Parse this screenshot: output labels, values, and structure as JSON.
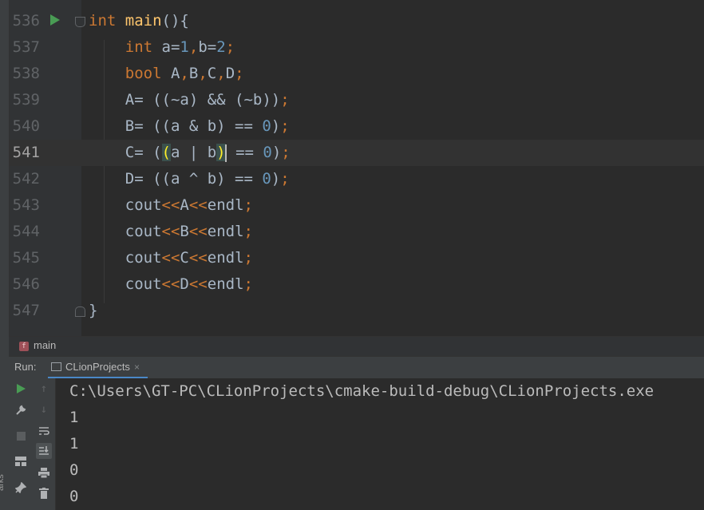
{
  "editor": {
    "lines": [
      {
        "num": "536",
        "tokens": [
          [
            "kw",
            "int"
          ],
          [
            "txt",
            " "
          ],
          [
            "fn",
            "main"
          ],
          [
            "txt",
            "(){"
          ]
        ]
      },
      {
        "num": "537",
        "tokens": [
          [
            "txt",
            "    "
          ],
          [
            "kw",
            "int"
          ],
          [
            "txt",
            " a="
          ],
          [
            "num",
            "1"
          ],
          [
            "kw",
            ","
          ],
          [
            "txt",
            "b="
          ],
          [
            "num",
            "2"
          ],
          [
            "kw",
            ";"
          ]
        ]
      },
      {
        "num": "538",
        "tokens": [
          [
            "txt",
            "    "
          ],
          [
            "kw",
            "bool"
          ],
          [
            "txt",
            " A"
          ],
          [
            "kw",
            ","
          ],
          [
            "txt",
            "B"
          ],
          [
            "kw",
            ","
          ],
          [
            "txt",
            "C"
          ],
          [
            "kw",
            ","
          ],
          [
            "txt",
            "D"
          ],
          [
            "kw",
            ";"
          ]
        ]
      },
      {
        "num": "539",
        "tokens": [
          [
            "txt",
            "    A= ((~a) && (~b))"
          ],
          [
            "kw",
            ";"
          ]
        ]
      },
      {
        "num": "540",
        "tokens": [
          [
            "txt",
            "    B= ((a & b) == "
          ],
          [
            "num",
            "0"
          ],
          [
            "txt",
            ")"
          ],
          [
            "kw",
            ";"
          ]
        ]
      },
      {
        "num": "541",
        "current": true,
        "tokens": [
          [
            "txt",
            "    C= ("
          ],
          [
            "hl",
            "("
          ],
          [
            "txt",
            "a | b"
          ],
          [
            "hl",
            ")"
          ],
          [
            "caret",
            ""
          ],
          [
            "txt",
            " == "
          ],
          [
            "num",
            "0"
          ],
          [
            "txt",
            ")"
          ],
          [
            "kw",
            ";"
          ]
        ]
      },
      {
        "num": "542",
        "tokens": [
          [
            "txt",
            "    D= ((a ^ b) == "
          ],
          [
            "num",
            "0"
          ],
          [
            "txt",
            ")"
          ],
          [
            "kw",
            ";"
          ]
        ]
      },
      {
        "num": "543",
        "tokens": [
          [
            "txt",
            "    cout"
          ],
          [
            "kw",
            "<<"
          ],
          [
            "txt",
            "A"
          ],
          [
            "kw",
            "<<"
          ],
          [
            "txt",
            "endl"
          ],
          [
            "kw",
            ";"
          ]
        ]
      },
      {
        "num": "544",
        "tokens": [
          [
            "txt",
            "    cout"
          ],
          [
            "kw",
            "<<"
          ],
          [
            "txt",
            "B"
          ],
          [
            "kw",
            "<<"
          ],
          [
            "txt",
            "endl"
          ],
          [
            "kw",
            ";"
          ]
        ]
      },
      {
        "num": "545",
        "tokens": [
          [
            "txt",
            "    cout"
          ],
          [
            "kw",
            "<<"
          ],
          [
            "txt",
            "C"
          ],
          [
            "kw",
            "<<"
          ],
          [
            "txt",
            "endl"
          ],
          [
            "kw",
            ";"
          ]
        ]
      },
      {
        "num": "546",
        "tokens": [
          [
            "txt",
            "    cout"
          ],
          [
            "kw",
            "<<"
          ],
          [
            "txt",
            "D"
          ],
          [
            "kw",
            "<<"
          ],
          [
            "txt",
            "endl"
          ],
          [
            "kw",
            ";"
          ]
        ]
      },
      {
        "num": "547",
        "tokens": [
          [
            "txt",
            "}"
          ]
        ]
      }
    ]
  },
  "breadcrumb": {
    "icon_letter": "f",
    "label": "main"
  },
  "run": {
    "label": "Run:",
    "tab_label": "CLionProjects",
    "tab_close": "×"
  },
  "console": {
    "lines": [
      "C:\\Users\\GT-PC\\CLionProjects\\cmake-build-debug\\CLionProjects.exe",
      "1",
      "1",
      "0",
      "0"
    ]
  },
  "side_panel": {
    "label": "arks"
  },
  "icons": {
    "run_gutter": "run-play-icon",
    "rerun": "rerun-icon",
    "settings": "wrench-icon",
    "stop": "stop-icon",
    "layout": "layout-icon",
    "pin": "pin-icon",
    "up": "arrow-up-icon",
    "down": "arrow-down-icon",
    "wrap": "soft-wrap-icon",
    "scroll_end": "scroll-to-end-icon",
    "print": "print-icon",
    "trash": "trash-icon"
  },
  "colors": {
    "background": "#2b2b2b",
    "keyword": "#cc7832",
    "function": "#ffc66d",
    "number": "#6897bb",
    "text": "#a9b7c6",
    "run_green": "#499c54"
  }
}
